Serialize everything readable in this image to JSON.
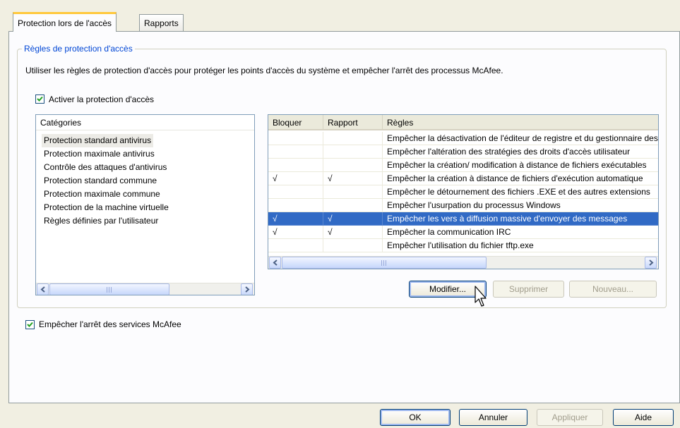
{
  "tabs": [
    {
      "label": "Protection lors de l'accès",
      "active": true
    },
    {
      "label": "Rapports",
      "active": false
    }
  ],
  "group": {
    "title": "Règles de protection d'accès",
    "description": "Utiliser les règles de protection d'accès pour protéger les points d'accès du système et empêcher l'arrêt des processus McAfee.",
    "enable_checkbox": {
      "label": "Activer la protection d'accès",
      "checked": true
    }
  },
  "categories": {
    "header": "Catégories",
    "items": [
      "Protection standard antivirus",
      "Protection maximale antivirus",
      "Contrôle des attaques d'antivirus",
      "Protection standard commune",
      "Protection maximale commune",
      "Protection de la machine virtuelle",
      "Règles définies par l'utilisateur"
    ],
    "selected_index": 0
  },
  "rules": {
    "headers": {
      "block": "Bloquer",
      "report": "Rapport",
      "rule": "Règles"
    },
    "rows": [
      {
        "block": "",
        "report": "",
        "rule": "Empêcher la désactivation de l'éditeur de registre et du gestionnaire des tâches"
      },
      {
        "block": "",
        "report": "",
        "rule": "Empêcher l'altération des stratégies des droits d'accès utilisateur"
      },
      {
        "block": "",
        "report": "",
        "rule": "Empêcher la création/ modification à distance de fichiers exécutables"
      },
      {
        "block": "√",
        "report": "√",
        "rule": "Empêcher la création à distance de fichiers d'exécution automatique"
      },
      {
        "block": "",
        "report": "",
        "rule": "Empêcher le détournement des fichiers .EXE et des autres extensions"
      },
      {
        "block": "",
        "report": "",
        "rule": "Empêcher l'usurpation du processus Windows"
      },
      {
        "block": "√",
        "report": "√",
        "rule": "Empêcher les vers à  diffusion massive d'envoyer des messages"
      },
      {
        "block": "√",
        "report": "√",
        "rule": "Empêcher la communication IRC"
      },
      {
        "block": "",
        "report": "",
        "rule": "Empêcher l'utilisation du fichier tftp.exe"
      }
    ],
    "selected_index": 6,
    "scroll_grip": "III"
  },
  "rule_buttons": {
    "edit": "Modifier...",
    "delete": "Supprimer",
    "new": "Nouveau..."
  },
  "stop_services_checkbox": {
    "label": "Empêcher l'arrêt des services McAfee",
    "checked": true
  },
  "dialog_buttons": {
    "ok": "OK",
    "cancel": "Annuler",
    "apply": "Appliquer",
    "help": "Aide"
  },
  "colors": {
    "selection": "#316ac5",
    "group_title": "#0046d5",
    "window_bg": "#f1efe2"
  },
  "icons": {
    "checkbox": "checkmark-icon",
    "scroll_left": "arrow-left-icon",
    "scroll_right": "arrow-right-icon",
    "pointer": "mouse-cursor-icon"
  }
}
